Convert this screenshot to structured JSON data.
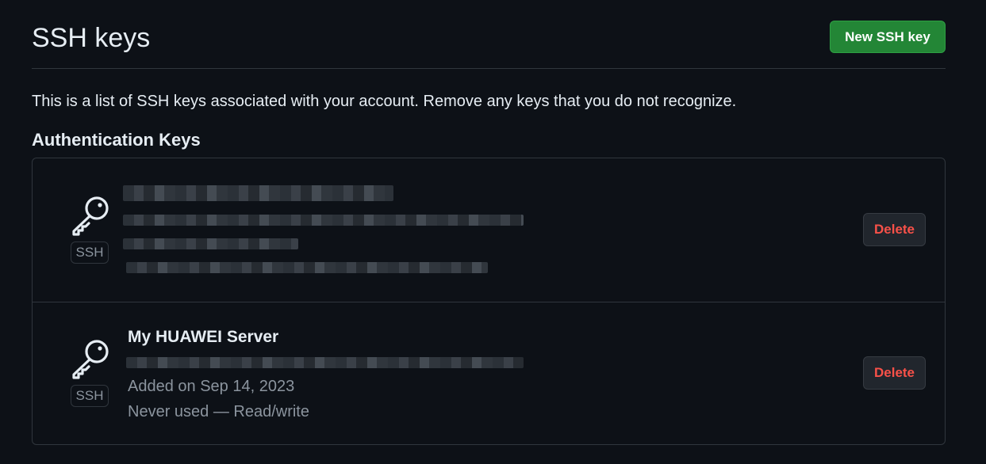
{
  "header": {
    "title": "SSH keys",
    "new_key_label": "New SSH key"
  },
  "description": "This is a list of SSH keys associated with your account. Remove any keys that you do not recognize.",
  "section_title": "Authentication Keys",
  "keys": [
    {
      "title": "",
      "badge": "SSH",
      "icon": "key-icon",
      "delete_label": "Delete",
      "redacted": true
    },
    {
      "title": "My HUAWEI Server",
      "badge": "SSH",
      "icon": "key-icon",
      "added": "Added on Sep 14, 2023",
      "usage": "Never used — Read/write",
      "delete_label": "Delete",
      "redacted_fingerprint": true
    }
  ],
  "colors": {
    "background": "#0d1117",
    "primary_button": "#238636",
    "danger": "#f85149",
    "muted": "#8b949e",
    "border": "#30363d"
  }
}
